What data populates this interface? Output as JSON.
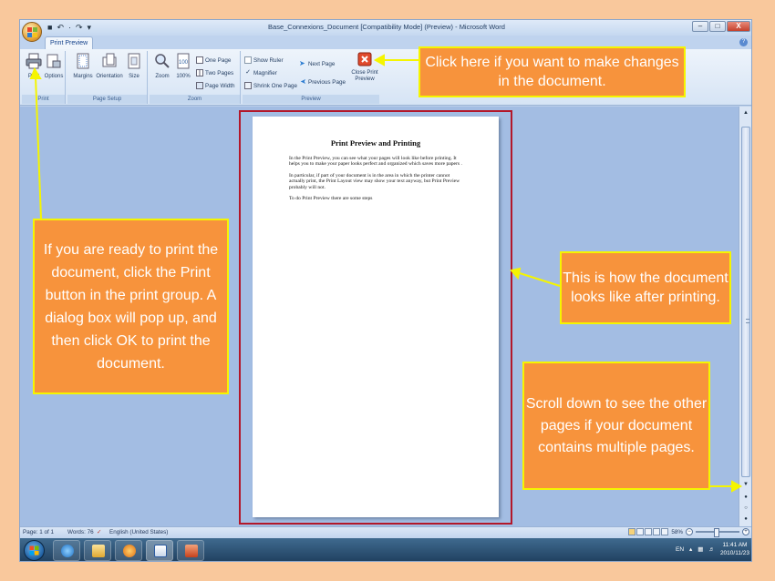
{
  "window": {
    "title": "Base_Connexions_Document [Compatibility Mode] (Preview) - Microsoft Word",
    "qat": [
      "■",
      "↶",
      "·",
      "↷",
      "▾"
    ],
    "controls": [
      "–",
      "□",
      "X"
    ]
  },
  "tabs": {
    "active": "Print Preview",
    "help": "?"
  },
  "ribbon": {
    "print_group": {
      "label": "Print",
      "print": "Print",
      "options": "Options"
    },
    "page_setup_group": {
      "label": "Page Setup",
      "margins": "Margins",
      "orientation": "Orientation",
      "size": "Size",
      "launcher": "↘"
    },
    "zoom_group": {
      "label": "Zoom",
      "zoom": "Zoom",
      "zoom100": "100%",
      "one_page": "One Page",
      "two_pages": "Two Pages",
      "page_width": "Page Width"
    },
    "preview_group": {
      "label": "Preview",
      "show_ruler": "Show Ruler",
      "magnifier": "Magnifier",
      "magnifier_checked": true,
      "shrink_one_page": "Shrink One Page",
      "next_page": "Next Page",
      "previous_page": "Previous Page",
      "close_print_preview": "Close Print Preview"
    }
  },
  "document": {
    "title": "Print Preview  and Printing",
    "paragraphs": [
      "In the Print Preview, you can see what your pages will look like before printing. It helps you to make your paper looks perfect and organized which saves more papers .",
      "In particular, if part of your document is in the area in which the printer cannot actually print, the Print Layout view may show your text anyway, but Print Preview probably will not.",
      "To do Print Preview there are some steps"
    ]
  },
  "status": {
    "page": "Page: 1 of 1",
    "words": "Words: 76",
    "language": "English (United States)",
    "zoom": "58%"
  },
  "taskbar": {
    "language": "EN",
    "time": "11:41 AM",
    "date": "2010/11/23"
  },
  "callouts": {
    "close_preview": "Click here if you want to make changes in the document.",
    "print": "If you are ready to print the document, click the Print button in the print group. A dialog box will pop up, and then click OK to print the document.",
    "preview_look": "This is how the document looks like after printing.",
    "scroll": "Scroll down to see the other pages if your document contains multiple pages."
  },
  "colors": {
    "background": "#f9c89c",
    "callout_fill": "#f7933c",
    "callout_border": "#f5f500",
    "page_frame": "#b3172a",
    "workspace": "#a3bde3"
  }
}
